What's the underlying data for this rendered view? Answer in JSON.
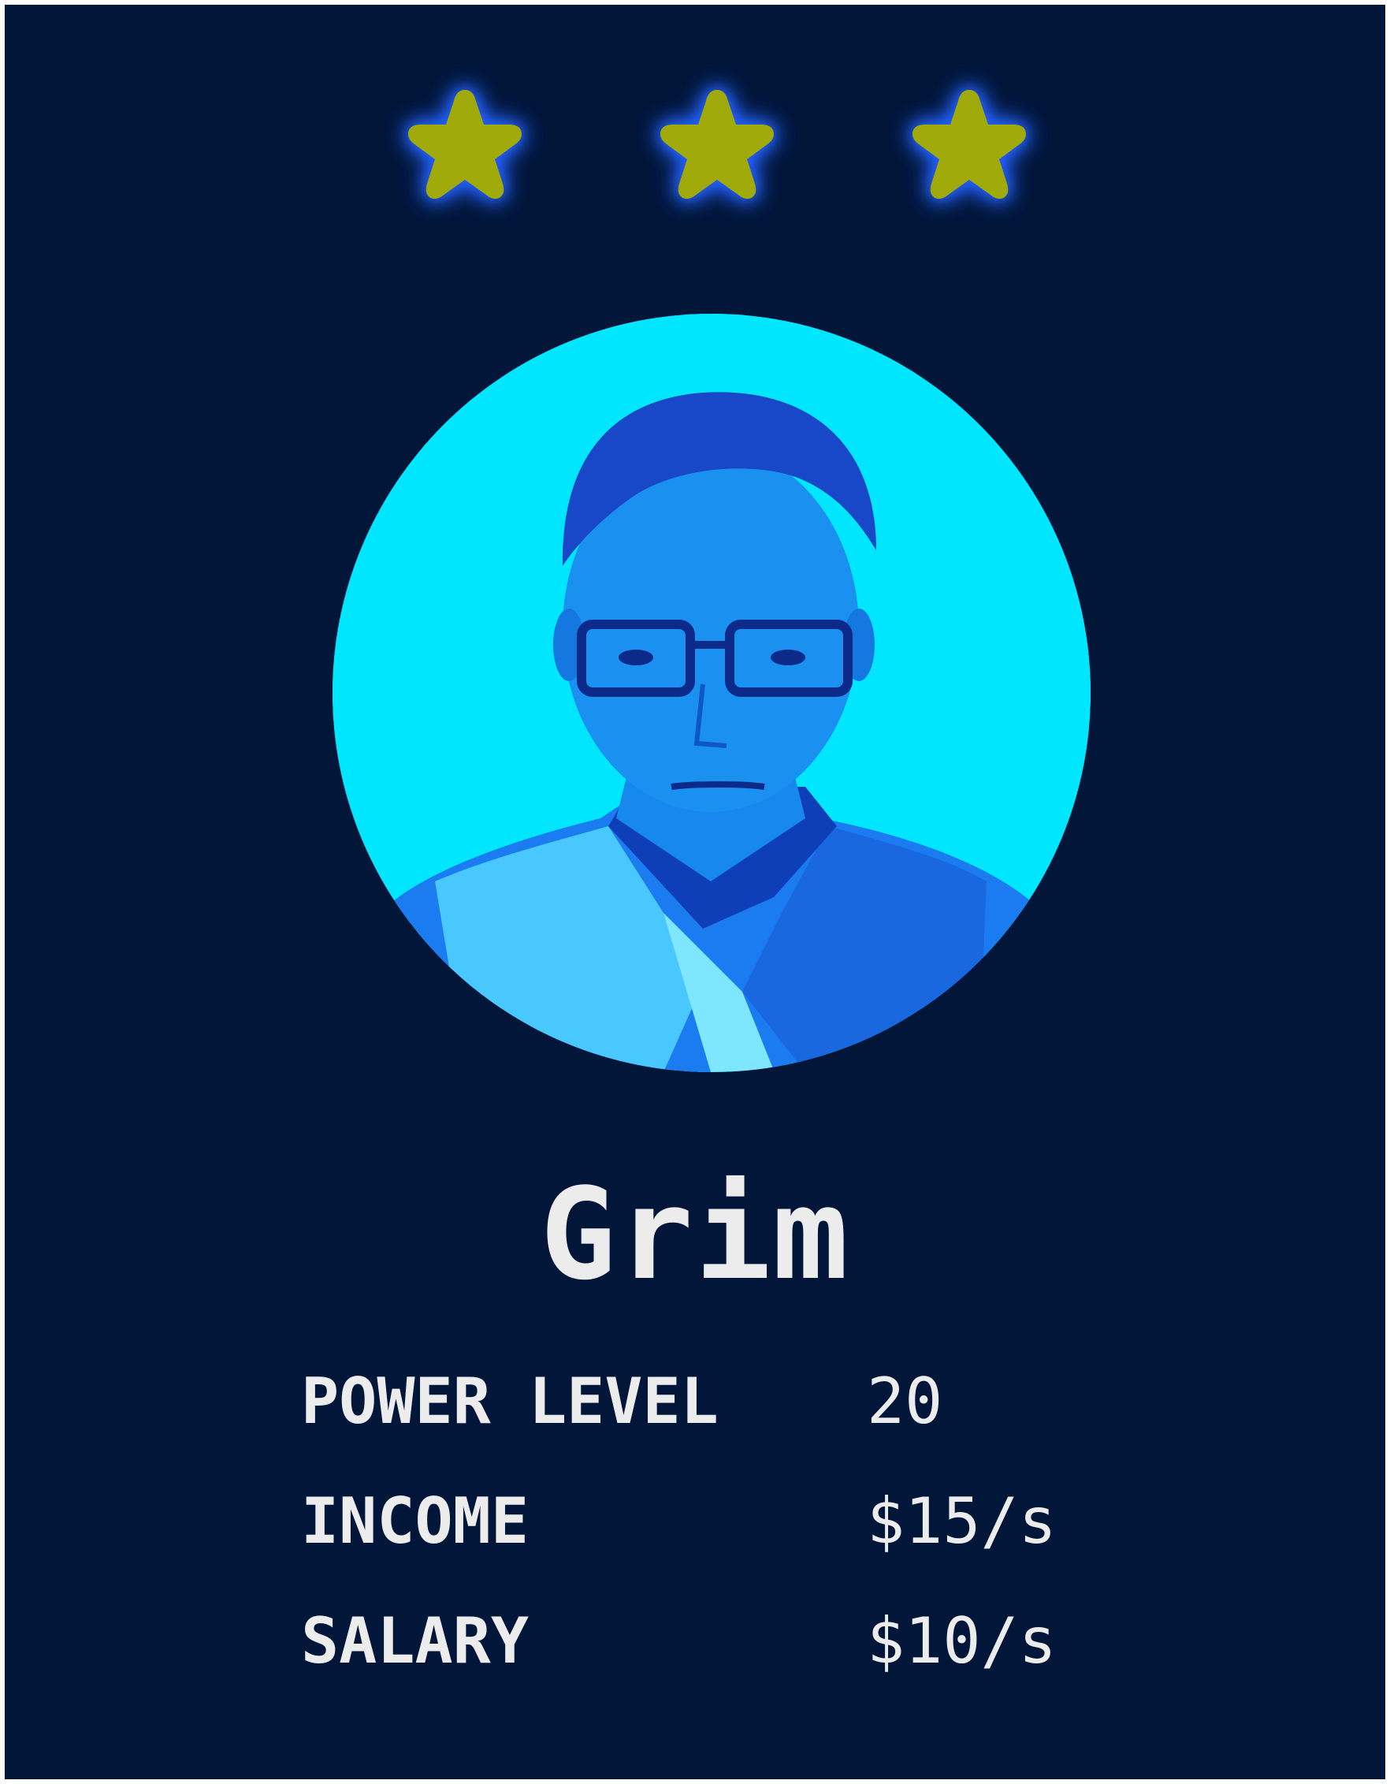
{
  "card": {
    "name": "Grim",
    "star_rating": 3,
    "star_color": "#a0aa0a",
    "glow_color": "#1f5cff",
    "background_color": "#02163a",
    "portrait_tint": "#00e6ff",
    "portrait_icon": "player-portrait",
    "stats": [
      {
        "label": "POWER LEVEL",
        "value": "20"
      },
      {
        "label": "INCOME",
        "value": "$15/s"
      },
      {
        "label": "SALARY",
        "value": "$10/s"
      }
    ]
  }
}
